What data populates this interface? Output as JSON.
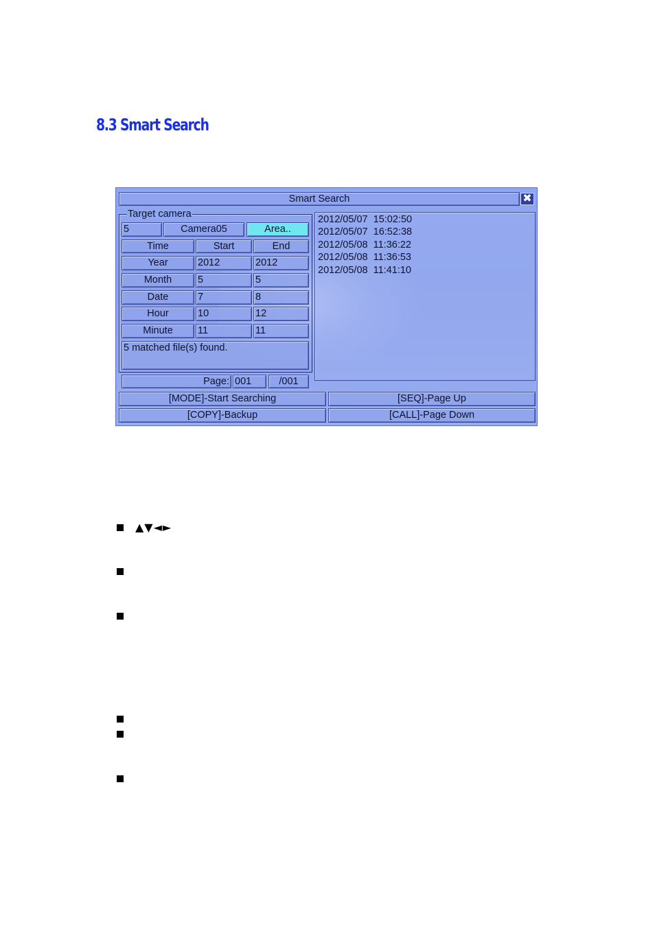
{
  "heading": "8.3 Smart Search",
  "dialog": {
    "title": "Smart Search",
    "close_symbol": "✖",
    "group_label": "Target camera",
    "camera_number": "5",
    "camera_name": "Camera05",
    "area_button": "Area..",
    "columns": {
      "time": "Time",
      "start": "Start",
      "end": "End"
    },
    "rows": [
      {
        "label": "Year",
        "start": "2012",
        "end": "2012"
      },
      {
        "label": "Month",
        "start": "5",
        "end": "5"
      },
      {
        "label": "Date",
        "start": "7",
        "end": "8"
      },
      {
        "label": "Hour",
        "start": "10",
        "end": "12"
      },
      {
        "label": "Minute",
        "start": "11",
        "end": "11"
      }
    ],
    "status": "5 matched file(s) found.",
    "page_label": "Page:",
    "page_current": "001",
    "page_total": "/001",
    "results": [
      "2012/05/07  15:02:50",
      "2012/05/07  16:52:38",
      "2012/05/08  11:36:22",
      "2012/05/08  11:36:53",
      "2012/05/08  11:41:10"
    ],
    "buttons": {
      "mode": "[MODE]-Start Searching",
      "seq": "[SEQ]-Page Up",
      "copy": "[COPY]-Backup",
      "call": "[CALL]-Page Down"
    },
    "colors": {
      "panel": "#8fa7ef",
      "highlight": "#70e6f0",
      "heading": "#1a2fe8"
    }
  },
  "arrow_keys": "▲▼◄►"
}
